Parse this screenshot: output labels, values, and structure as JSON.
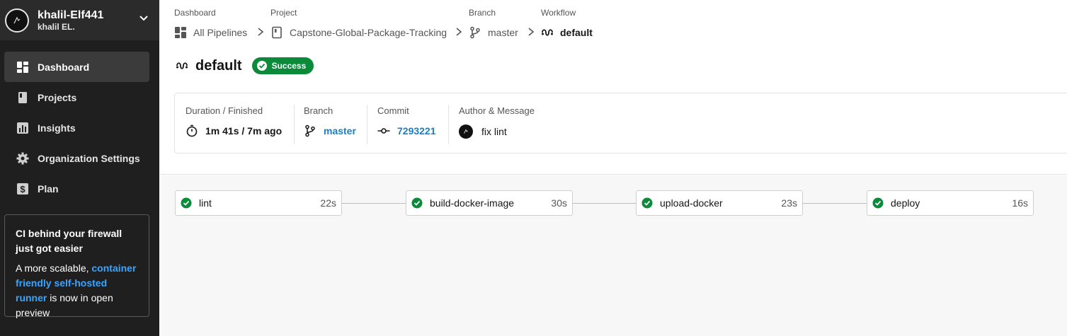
{
  "sidebar": {
    "org_name": "khalil-Elf441",
    "org_user": "khalil EL.",
    "items": [
      {
        "label": "Dashboard",
        "icon": "dashboard-icon",
        "active": true
      },
      {
        "label": "Projects",
        "icon": "projects-icon",
        "active": false
      },
      {
        "label": "Insights",
        "icon": "insights-icon",
        "active": false
      },
      {
        "label": "Organization Settings",
        "icon": "gear-icon",
        "active": false
      },
      {
        "label": "Plan",
        "icon": "dollar-icon",
        "active": false
      }
    ],
    "promo": {
      "title": "CI behind your firewall just got easier",
      "body_prefix": "A more scalable, ",
      "link": "container friendly self-hosted runner",
      "body_suffix": " is now in open preview"
    }
  },
  "breadcrumb": {
    "dashboard": {
      "label": "Dashboard",
      "value": "All Pipelines"
    },
    "project": {
      "label": "Project",
      "value": "Capstone-Global-Package-Tracking"
    },
    "branch": {
      "label": "Branch",
      "value": "master"
    },
    "workflow": {
      "label": "Workflow",
      "value": "default"
    }
  },
  "workflow": {
    "title": "default",
    "status": "Success",
    "status_color": "#0b8a3a"
  },
  "summary": {
    "duration": {
      "label": "Duration / Finished",
      "value": "1m 41s / 7m ago"
    },
    "branch": {
      "label": "Branch",
      "value": "master"
    },
    "commit": {
      "label": "Commit",
      "value": "7293221"
    },
    "author": {
      "label": "Author & Message",
      "value": "fix lint"
    }
  },
  "jobs": [
    {
      "name": "lint",
      "duration": "22s",
      "status": "success"
    },
    {
      "name": "build-docker-image",
      "duration": "30s",
      "status": "success"
    },
    {
      "name": "upload-docker",
      "duration": "23s",
      "status": "success"
    },
    {
      "name": "deploy",
      "duration": "16s",
      "status": "success"
    }
  ],
  "colors": {
    "sidebar_bg": "#1f1f1f",
    "link": "#1a7ec6",
    "success": "#0b8a3a"
  }
}
